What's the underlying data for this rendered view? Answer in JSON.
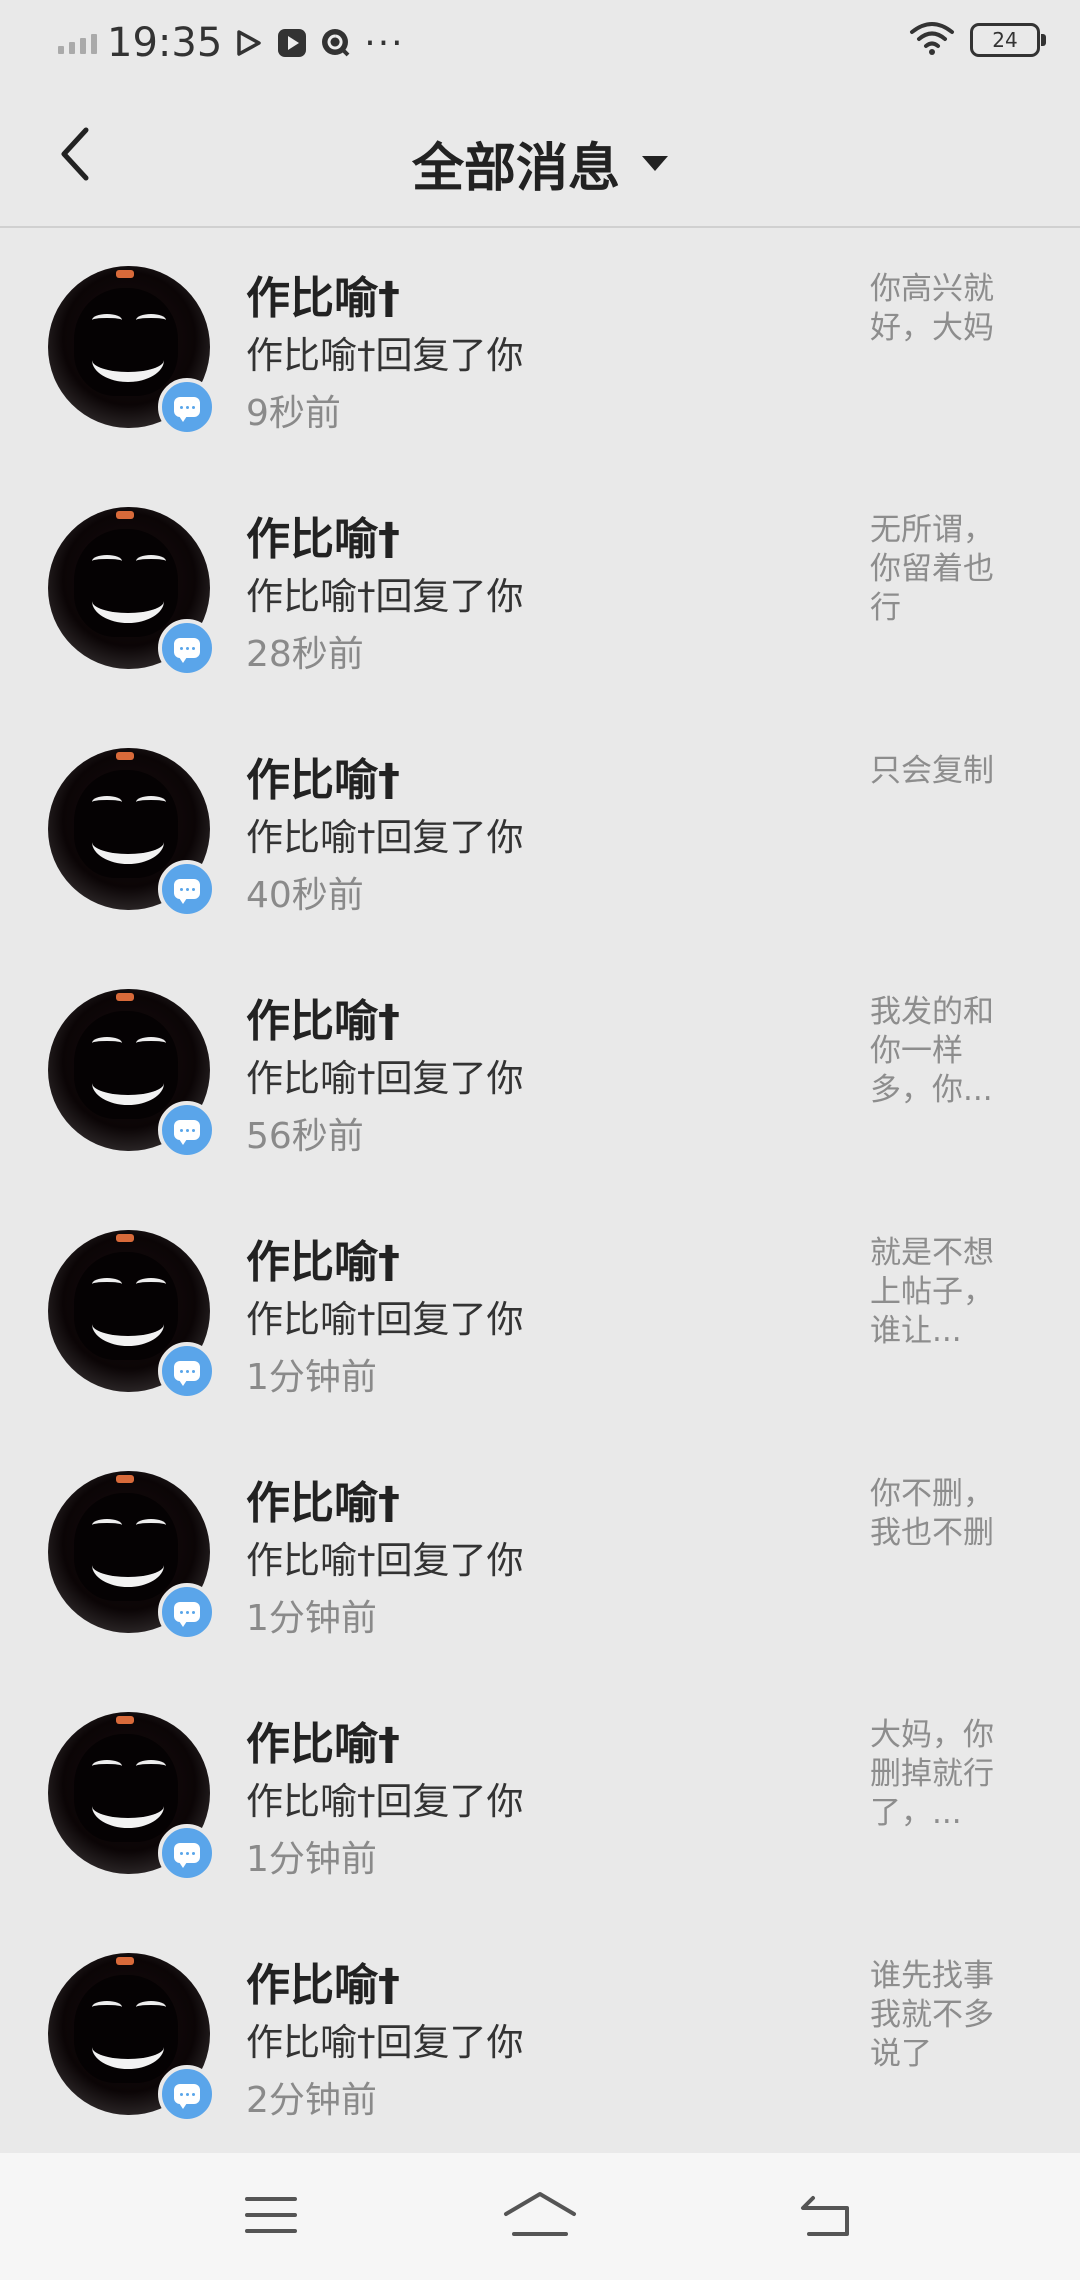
{
  "status_bar": {
    "time": "19:35",
    "more": "···",
    "battery": "24",
    "icons": [
      "signal-icon",
      "play-icon",
      "record-icon",
      "qq-icon",
      "wifi-icon",
      "battery-icon"
    ]
  },
  "header": {
    "title": "全部消息",
    "back_icon": "chevron-left-icon",
    "dropdown_icon": "caret-down-icon"
  },
  "messages": [
    {
      "name": "作比喻†",
      "action": "作比喻†回复了你",
      "time": "9秒前",
      "preview": "你高兴就好，大妈"
    },
    {
      "name": "作比喻†",
      "action": "作比喻†回复了你",
      "time": "28秒前",
      "preview": "无所谓，你留着也行"
    },
    {
      "name": "作比喻†",
      "action": "作比喻†回复了你",
      "time": "40秒前",
      "preview": "只会复制"
    },
    {
      "name": "作比喻†",
      "action": "作比喻†回复了你",
      "time": "56秒前",
      "preview": "我发的和你一样多，你..."
    },
    {
      "name": "作比喻†",
      "action": "作比喻†回复了你",
      "time": "1分钟前",
      "preview": "就是不想上帖子，谁让..."
    },
    {
      "name": "作比喻†",
      "action": "作比喻†回复了你",
      "time": "1分钟前",
      "preview": "你不删，我也不删"
    },
    {
      "name": "作比喻†",
      "action": "作比喻†回复了你",
      "time": "1分钟前",
      "preview": "大妈，你删掉就行了，..."
    },
    {
      "name": "作比喻†",
      "action": "作比喻†回复了你",
      "time": "2分钟前",
      "preview": "谁先找事我就不多说了"
    }
  ],
  "system_nav": {
    "icons": [
      "menu-icon",
      "home-icon",
      "back-icon"
    ]
  },
  "colors": {
    "background": "#e9e9e9",
    "badge": "#5aa5ea",
    "secondary_text": "#8a8a8a"
  }
}
